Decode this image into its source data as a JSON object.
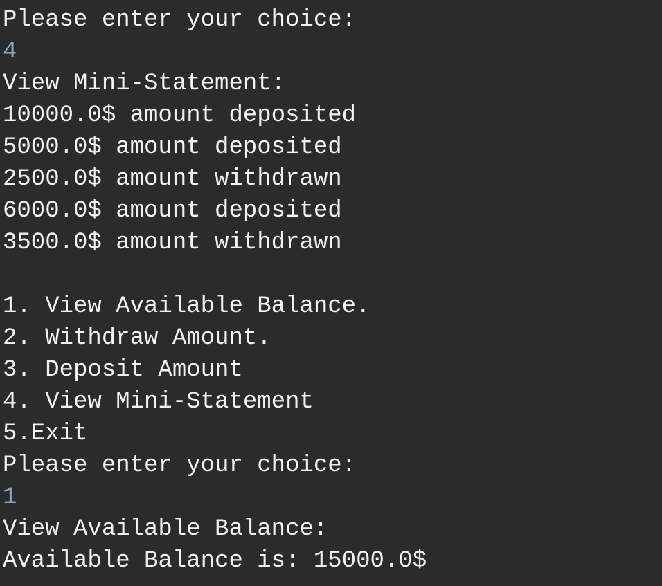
{
  "colors": {
    "background": "#2b2b2b",
    "output_text": "#f2f2f2",
    "user_input_text": "#8aa8c8"
  },
  "console": {
    "lines": [
      {
        "text": "Please enter your choice:",
        "kind": "output"
      },
      {
        "text": "4",
        "kind": "input"
      },
      {
        "text": "View Mini-Statement:",
        "kind": "output"
      },
      {
        "text": "10000.0$ amount deposited",
        "kind": "output"
      },
      {
        "text": "5000.0$ amount deposited",
        "kind": "output"
      },
      {
        "text": "2500.0$ amount withdrawn",
        "kind": "output"
      },
      {
        "text": "6000.0$ amount deposited",
        "kind": "output"
      },
      {
        "text": "3500.0$ amount withdrawn",
        "kind": "output"
      },
      {
        "text": "",
        "kind": "output"
      },
      {
        "text": "1. View Available Balance.",
        "kind": "output"
      },
      {
        "text": "2. Withdraw Amount.",
        "kind": "output"
      },
      {
        "text": "3. Deposit Amount",
        "kind": "output"
      },
      {
        "text": "4. View Mini-Statement",
        "kind": "output"
      },
      {
        "text": "5.Exit",
        "kind": "output"
      },
      {
        "text": "Please enter your choice:",
        "kind": "output"
      },
      {
        "text": "1",
        "kind": "input"
      },
      {
        "text": "View Available Balance:",
        "kind": "output"
      },
      {
        "text": "Available Balance is: 15000.0$",
        "kind": "output"
      }
    ]
  }
}
